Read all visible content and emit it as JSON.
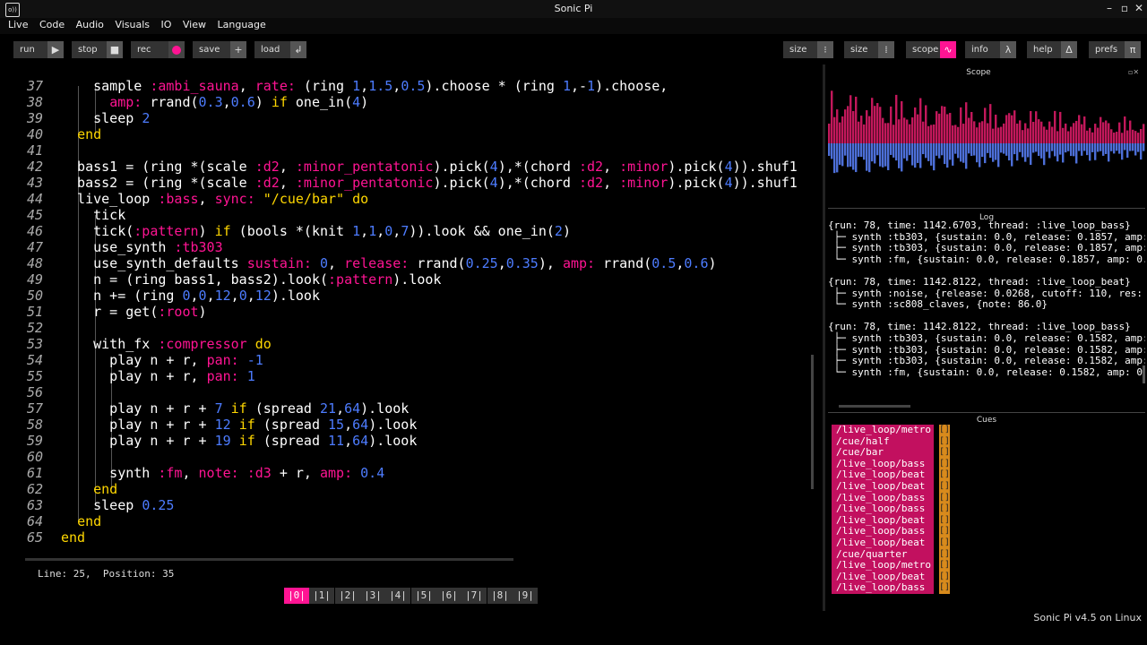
{
  "window": {
    "title": "Sonic Pi",
    "icon_label": "o))",
    "controls": [
      "minimize-icon",
      "maximize-icon",
      "close-icon"
    ]
  },
  "menu": [
    "Live",
    "Code",
    "Audio",
    "Visuals",
    "IO",
    "View",
    "Language"
  ],
  "toolbar": {
    "run": "run",
    "stop": "stop",
    "rec": "rec",
    "save": "save",
    "load": "load",
    "size1": "size",
    "size2": "size",
    "scope": "scope",
    "info": "info",
    "help": "help",
    "prefs": "prefs"
  },
  "editor": {
    "lines": [
      {
        "n": "37",
        "html": "    sample <span class='sym'>:ambi_sauna</span>, <span class='k'>rate:</span> (ring <span class='n'>1</span>,<span class='n'>1.5</span>,<span class='n'>0.5</span>).choose * (ring <span class='n'>1</span>,-<span class='n'>1</span>).choose,"
      },
      {
        "n": "38",
        "html": "      <span class='k'>amp:</span> rrand(<span class='n'>0.3</span>,<span class='n'>0.6</span>) <span class='y'>if</span> one_in(<span class='n'>4</span>)"
      },
      {
        "n": "39",
        "html": "    sleep <span class='n'>2</span>"
      },
      {
        "n": "40",
        "html": "  <span class='y'>end</span>"
      },
      {
        "n": "41",
        "html": ""
      },
      {
        "n": "42",
        "html": "  bass1 = (ring *(scale <span class='sym'>:d2</span>, <span class='sym'>:minor_pentatonic</span>).pick(<span class='n'>4</span>),*(chord <span class='sym'>:d2</span>, <span class='sym'>:minor</span>).pick(<span class='n'>4</span>)).shuf1"
      },
      {
        "n": "43",
        "html": "  bass2 = (ring *(scale <span class='sym'>:d2</span>, <span class='sym'>:minor_pentatonic</span>).pick(<span class='n'>4</span>),*(chord <span class='sym'>:d2</span>, <span class='sym'>:minor</span>).pick(<span class='n'>4</span>)).shuf1"
      },
      {
        "n": "44",
        "html": "  live_loop <span class='sym'>:bass</span>, <span class='k'>sync:</span> <span class='y'>\"/cue/bar\"</span> <span class='y'>do</span>"
      },
      {
        "n": "45",
        "html": "    tick"
      },
      {
        "n": "46",
        "html": "    tick(<span class='sym'>:pattern</span>) <span class='y'>if</span> (bools *(knit <span class='n'>1</span>,<span class='n'>1</span>,<span class='n'>0</span>,<span class='n'>7</span>)).look &amp;&amp; one_in(<span class='n'>2</span>)"
      },
      {
        "n": "47",
        "html": "    use_synth <span class='sym'>:tb303</span>"
      },
      {
        "n": "48",
        "html": "    use_synth_defaults <span class='k'>sustain:</span> <span class='n'>0</span>, <span class='k'>release:</span> rrand(<span class='n'>0.25</span>,<span class='n'>0.35</span>), <span class='k'>amp:</span> rrand(<span class='n'>0.5</span>,<span class='n'>0.6</span>)"
      },
      {
        "n": "49",
        "html": "    n = (ring bass1, bass2).look(<span class='sym'>:pattern</span>).look"
      },
      {
        "n": "50",
        "html": "    n += (ring <span class='n'>0</span>,<span class='n'>0</span>,<span class='n'>12</span>,<span class='n'>0</span>,<span class='n'>12</span>).look"
      },
      {
        "n": "51",
        "html": "    r = get(<span class='sym'>:root</span>)"
      },
      {
        "n": "52",
        "html": ""
      },
      {
        "n": "53",
        "html": "    with_fx <span class='sym'>:compressor</span> <span class='y'>do</span>"
      },
      {
        "n": "54",
        "html": "      play n + r, <span class='k'>pan:</span> <span class='n'>-1</span>"
      },
      {
        "n": "55",
        "html": "      play n + r, <span class='k'>pan:</span> <span class='n'>1</span>"
      },
      {
        "n": "56",
        "html": ""
      },
      {
        "n": "57",
        "html": "      play n + r + <span class='n'>7</span> <span class='y'>if</span> (spread <span class='n'>21</span>,<span class='n'>64</span>).look"
      },
      {
        "n": "58",
        "html": "      play n + r + <span class='n'>12</span> <span class='y'>if</span> (spread <span class='n'>15</span>,<span class='n'>64</span>).look"
      },
      {
        "n": "59",
        "html": "      play n + r + <span class='n'>19</span> <span class='y'>if</span> (spread <span class='n'>11</span>,<span class='n'>64</span>).look"
      },
      {
        "n": "60",
        "html": ""
      },
      {
        "n": "61",
        "html": "      synth <span class='sym'>:fm</span>, <span class='k'>note:</span> <span class='sym'>:d3</span> + r, <span class='k'>amp:</span> <span class='n'>0.4</span>"
      },
      {
        "n": "62",
        "html": "    <span class='y'>end</span>"
      },
      {
        "n": "63",
        "html": "    sleep <span class='n'>0.25</span>"
      },
      {
        "n": "64",
        "html": "  <span class='y'>end</span>"
      },
      {
        "n": "65",
        "html": "<span class='y'>end</span>"
      }
    ]
  },
  "status": {
    "line_label": "Line: 25,",
    "position_label": "Position: 35"
  },
  "buffers": [
    "|0|",
    "|1|",
    "|2|",
    "|3|",
    "|4|",
    "|5|",
    "|6|",
    "|7|",
    "|8|",
    "|9|"
  ],
  "panes": {
    "scope": "Scope",
    "log": "Log",
    "cues": "Cues"
  },
  "log": [
    "{run: 78, time: 1142.6703, thread: :live_loop_bass}",
    " ├─ synth :tb303, {sustain: 0.0, release: 0.1857, amp:",
    " ├─ synth :tb303, {sustain: 0.0, release: 0.1857, amp:",
    " └─ synth :fm, {sustain: 0.0, release: 0.1857, amp: 0.",
    "",
    "{run: 78, time: 1142.8122, thread: :live_loop_beat}",
    " ├─ synth :noise, {release: 0.0268, cutoff: 110, res: ",
    " └─ synth :sc808_claves, {note: 86.0}",
    "",
    "{run: 78, time: 1142.8122, thread: :live_loop_bass}",
    " ├─ synth :tb303, {sustain: 0.0, release: 0.1582, amp:",
    " ├─ synth :tb303, {sustain: 0.0, release: 0.1582, amp:",
    " ├─ synth :tb303, {sustain: 0.0, release: 0.1582, amp:",
    " └─ synth :fm, {sustain: 0.0, release: 0.1582, amp: 0."
  ],
  "cues": [
    {
      "path": "/live_loop/metro",
      "val": "[]"
    },
    {
      "path": "/cue/half",
      "val": "[]"
    },
    {
      "path": "/cue/bar",
      "val": "[]"
    },
    {
      "path": "/live_loop/bass",
      "val": "[]"
    },
    {
      "path": "/live_loop/beat",
      "val": "[]"
    },
    {
      "path": "/live_loop/beat",
      "val": "[]"
    },
    {
      "path": "/live_loop/bass",
      "val": "[]"
    },
    {
      "path": "/live_loop/bass",
      "val": "[]"
    },
    {
      "path": "/live_loop/beat",
      "val": "[]"
    },
    {
      "path": "/live_loop/bass",
      "val": "[]"
    },
    {
      "path": "/live_loop/beat",
      "val": "[]"
    },
    {
      "path": "/cue/quarter",
      "val": "[]"
    },
    {
      "path": "/live_loop/metro",
      "val": "[]"
    },
    {
      "path": "/live_loop/beat",
      "val": "[]"
    },
    {
      "path": "/live_loop/bass",
      "val": "[]"
    }
  ],
  "footer": "Sonic Pi v4.5 on Linux",
  "colors": {
    "accent": "#ff1493",
    "cue_bg": "#c2105f",
    "cue_val": "#d88a1c",
    "scope_top": "#c2185b",
    "scope_bottom": "#4d6fd8"
  }
}
